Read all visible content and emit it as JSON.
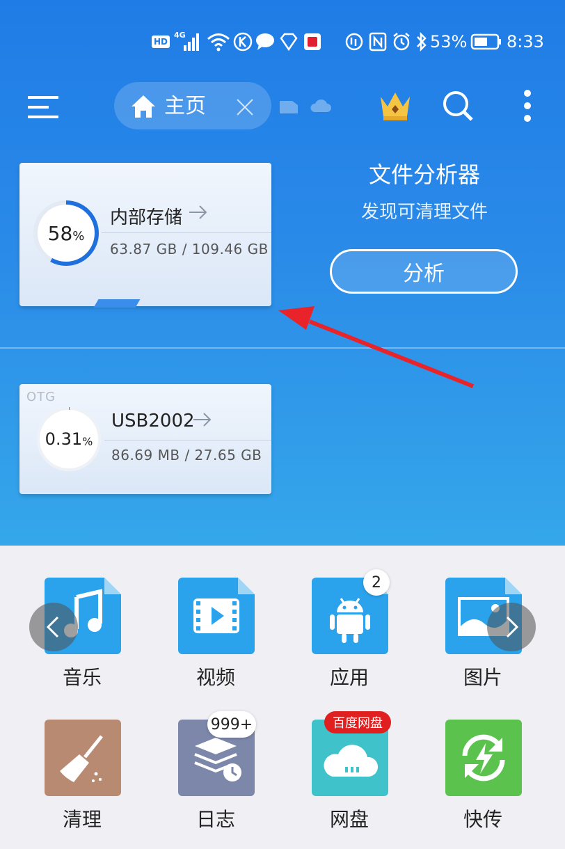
{
  "status_bar": {
    "hd": "HD",
    "net": "4G",
    "battery_pct": "53%",
    "time": "8:33",
    "icons": [
      "hd-icon",
      "signal-icon",
      "wifi-icon",
      "k-app-icon",
      "chat-icon",
      "heart-diamond-icon",
      "red-app-icon",
      "data-saver-icon",
      "nfc-icon",
      "alarm-icon",
      "bluetooth-icon",
      "battery-icon"
    ]
  },
  "toolbar": {
    "tab_label": "主页",
    "icons": [
      "menu-icon",
      "home-icon",
      "close-icon",
      "sd-card-icon",
      "cloud-icon",
      "crown-icon",
      "search-icon",
      "more-vert-icon"
    ]
  },
  "storage": [
    {
      "name": "内部存储",
      "percent": 58,
      "percent_text": "58",
      "percent_sign": "%",
      "size": "63.87 GB / 109.46 GB"
    },
    {
      "tag": "OTG",
      "name": "USB2002",
      "percent": 0.31,
      "percent_text": "0.31",
      "percent_sign": "%",
      "size": "86.69 MB / 27.65 GB"
    }
  ],
  "analyzer": {
    "title": "文件分析器",
    "subtitle": "发现可清理文件",
    "button": "分析"
  },
  "categories": [
    {
      "label": "音乐",
      "icon": "music-icon",
      "color": "#2aa3ec"
    },
    {
      "label": "视频",
      "icon": "video-icon",
      "color": "#2aa3ec"
    },
    {
      "label": "应用",
      "icon": "android-icon",
      "color": "#2aa3ec",
      "badge": "2"
    },
    {
      "label": "图片",
      "icon": "image-icon",
      "color": "#2aa3ec"
    },
    {
      "label": "清理",
      "icon": "broom-icon",
      "color": "#b88a72"
    },
    {
      "label": "日志",
      "icon": "log-icon",
      "color": "#7d87aa",
      "badge": "999+"
    },
    {
      "label": "网盘",
      "icon": "cloud-disk-icon",
      "color": "#3fc2c9",
      "badge_red": "百度网盘"
    },
    {
      "label": "快传",
      "icon": "quick-transfer-icon",
      "color": "#5bc24e"
    }
  ],
  "colors": {
    "header_top": "#1f7ce6",
    "header_bottom": "#35a7ea",
    "progress": "#1f6fdc",
    "annotation_arrow": "#e8232a"
  }
}
